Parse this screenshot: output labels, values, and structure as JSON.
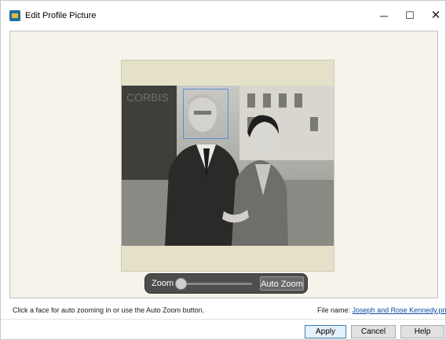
{
  "window": {
    "title": "Edit Profile Picture",
    "controls": {
      "minimize": "─",
      "maximize": "☐",
      "close": "✕"
    }
  },
  "photo": {
    "watermark_text": "CORBIS",
    "face_detection_box": "face-frame"
  },
  "zoombar": {
    "label": "Zoom",
    "slider_value": 0,
    "auto_zoom_label": "Auto Zoom"
  },
  "footer": {
    "hint": "Click a face for auto zooming in or use the Auto Zoom button.",
    "file_name_label": "File name:",
    "file_name": "Joseph and Rose Kennedy.png"
  },
  "buttons": {
    "apply": "Apply",
    "cancel": "Cancel",
    "help": "Help"
  },
  "colors": {
    "frame_bg": "#e5e1c9",
    "panel_bg": "#f5f3ea",
    "face_box": "#5b8fd9",
    "link": "#0b4aa8"
  }
}
